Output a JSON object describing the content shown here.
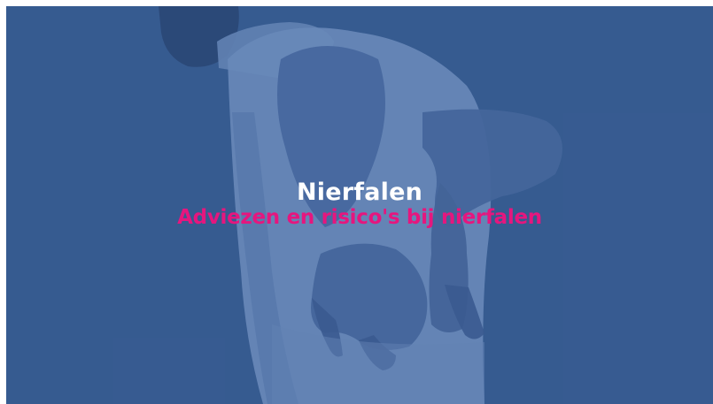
{
  "hero": {
    "title": "Nierfalen",
    "subtitle": "Adviezen en risico's bij nierfalen",
    "image_subject": "man holding his lower back",
    "overlay_color": "#3a5e92",
    "title_color": "#ffffff",
    "subtitle_color": "#e6167e"
  }
}
